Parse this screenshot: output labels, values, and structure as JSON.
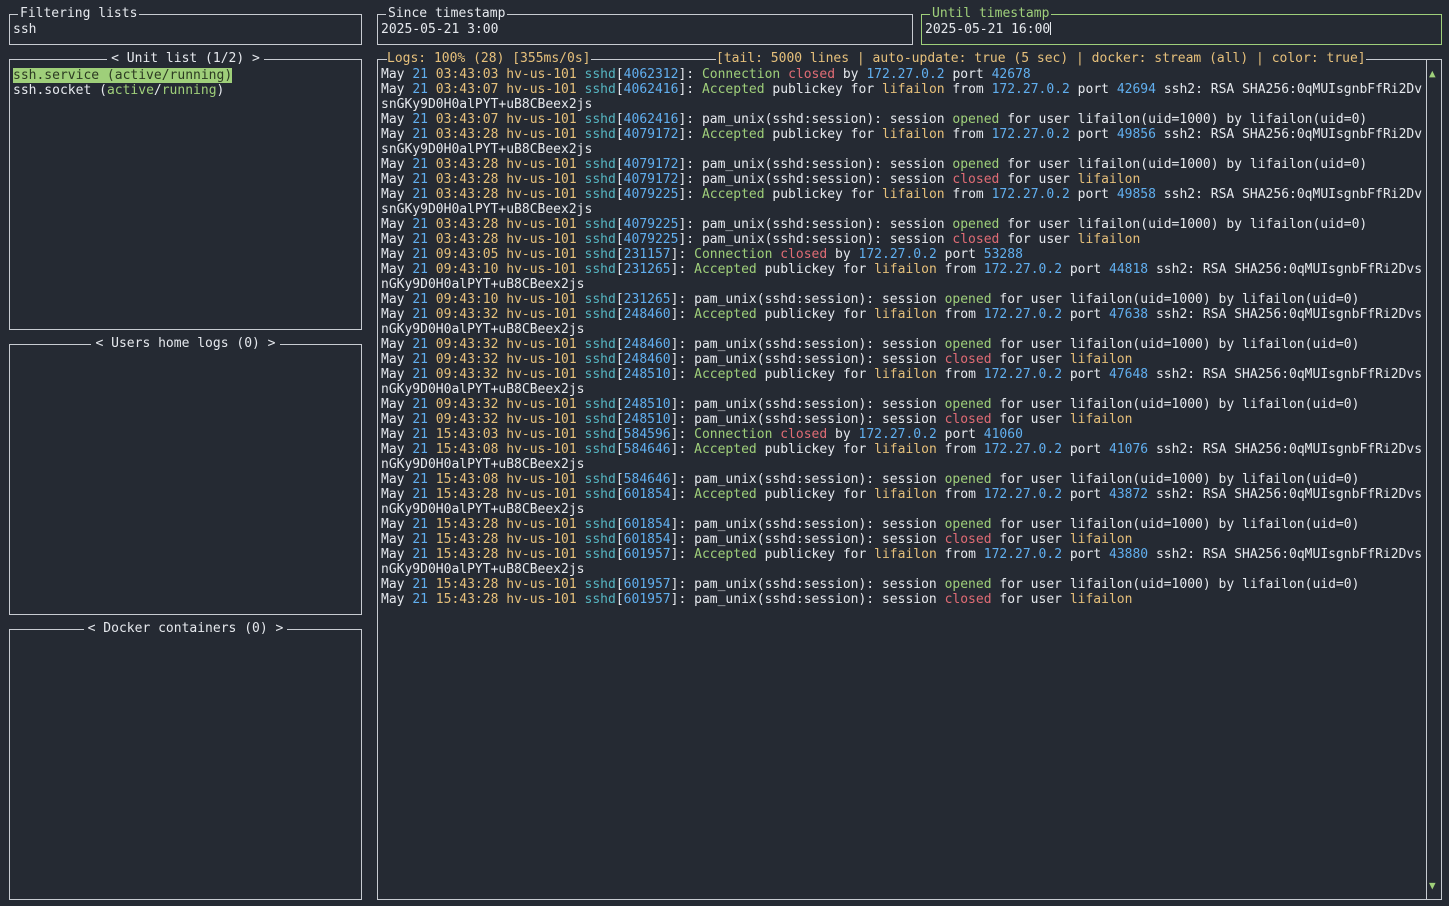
{
  "filter": {
    "title": "Filtering lists",
    "value": "ssh"
  },
  "since": {
    "title": "Since timestamp",
    "value": "2025-05-21 3:00"
  },
  "until": {
    "title": "Until timestamp",
    "value": "2025-05-21 16:00"
  },
  "unit_list": {
    "title": "< Unit list (1/2) >",
    "items": [
      {
        "name": "ssh.service",
        "state": "active",
        "sub": "running",
        "selected": true
      },
      {
        "name": "ssh.socket",
        "state": "active",
        "sub": "running",
        "selected": false
      }
    ]
  },
  "users_home_logs": {
    "title": "< Users home logs (0) >"
  },
  "docker_containers": {
    "title": "< Docker containers (0) >"
  },
  "logs": {
    "status": "Logs: 100% (28) [355ms/0s]",
    "settings": "[tail: 5000 lines | auto-update: true (5 sec) | docker: stream (all) | color: true]",
    "host": "hv-us-101",
    "user": "lifailon",
    "ip": "172.27.0.2",
    "key": "ssh2: RSA SHA256:0qMUIsgnbFfRi2DvsnGKy9D0H0alPYT+uB8CBeex2js",
    "lines": [
      {
        "time": "03:43:03",
        "pid": "4062312",
        "kind": "closed_conn",
        "port": "42678"
      },
      {
        "time": "03:43:07",
        "pid": "4062416",
        "kind": "accepted",
        "port": "42694"
      },
      {
        "time": "03:43:07",
        "pid": "4062416",
        "kind": "opened"
      },
      {
        "time": "03:43:28",
        "pid": "4079172",
        "kind": "accepted",
        "port": "49856"
      },
      {
        "time": "03:43:28",
        "pid": "4079172",
        "kind": "opened"
      },
      {
        "time": "03:43:28",
        "pid": "4079172",
        "kind": "closed"
      },
      {
        "time": "03:43:28",
        "pid": "4079225",
        "kind": "accepted",
        "port": "49858"
      },
      {
        "time": "03:43:28",
        "pid": "4079225",
        "kind": "opened"
      },
      {
        "time": "03:43:28",
        "pid": "4079225",
        "kind": "closed"
      },
      {
        "time": "09:43:05",
        "pid": "231157",
        "kind": "closed_conn",
        "port": "53288"
      },
      {
        "time": "09:43:10",
        "pid": "231265",
        "kind": "accepted",
        "port": "44818"
      },
      {
        "time": "09:43:10",
        "pid": "231265",
        "kind": "opened"
      },
      {
        "time": "09:43:32",
        "pid": "248460",
        "kind": "accepted",
        "port": "47638"
      },
      {
        "time": "09:43:32",
        "pid": "248460",
        "kind": "opened"
      },
      {
        "time": "09:43:32",
        "pid": "248460",
        "kind": "closed"
      },
      {
        "time": "09:43:32",
        "pid": "248510",
        "kind": "accepted",
        "port": "47648"
      },
      {
        "time": "09:43:32",
        "pid": "248510",
        "kind": "opened"
      },
      {
        "time": "09:43:32",
        "pid": "248510",
        "kind": "closed"
      },
      {
        "time": "15:43:03",
        "pid": "584596",
        "kind": "closed_conn",
        "port": "41060"
      },
      {
        "time": "15:43:08",
        "pid": "584646",
        "kind": "accepted",
        "port": "41076"
      },
      {
        "time": "15:43:08",
        "pid": "584646",
        "kind": "opened"
      },
      {
        "time": "15:43:28",
        "pid": "601854",
        "kind": "accepted",
        "port": "43872"
      },
      {
        "time": "15:43:28",
        "pid": "601854",
        "kind": "opened"
      },
      {
        "time": "15:43:28",
        "pid": "601854",
        "kind": "closed"
      },
      {
        "time": "15:43:28",
        "pid": "601957",
        "kind": "accepted",
        "port": "43880"
      },
      {
        "time": "15:43:28",
        "pid": "601957",
        "kind": "opened"
      },
      {
        "time": "15:43:28",
        "pid": "601957",
        "kind": "closed"
      }
    ]
  },
  "scroll": {
    "up_icon": "▲",
    "down_icon": "▼"
  },
  "colors": {
    "accent": "#9fcf7a",
    "background": "#252a33",
    "red": "#e06c75",
    "blue": "#61afef",
    "yellow": "#e6c07b"
  }
}
